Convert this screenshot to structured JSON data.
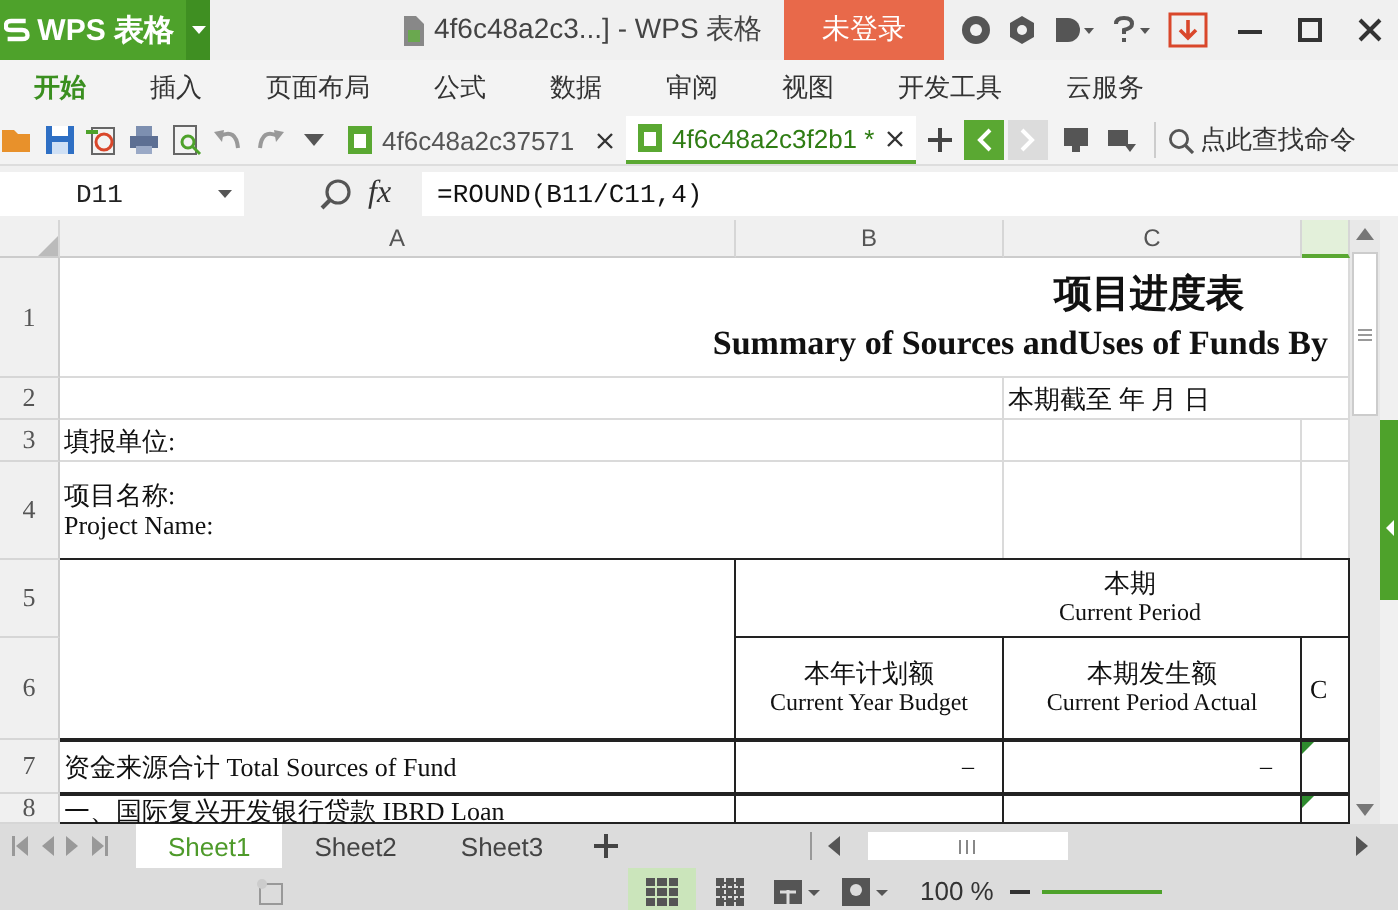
{
  "title_bar": {
    "app_name": "WPS 表格",
    "document_title": "4f6c48a2c3...] - WPS 表格",
    "login_button": "未登录"
  },
  "menu": [
    {
      "label": "开始",
      "selected": true
    },
    {
      "label": "插入",
      "selected": false
    },
    {
      "label": "页面布局",
      "selected": false
    },
    {
      "label": "公式",
      "selected": false
    },
    {
      "label": "数据",
      "selected": false
    },
    {
      "label": "审阅",
      "selected": false
    },
    {
      "label": "视图",
      "selected": false
    },
    {
      "label": "开发工具",
      "selected": false
    },
    {
      "label": "云服务",
      "selected": false
    }
  ],
  "doc_tabs": [
    {
      "label": "4f6c48a2c37571",
      "selected": false
    },
    {
      "label": "4f6c48a2c3f2b1 *",
      "selected": true
    }
  ],
  "search": {
    "placeholder": "点此查找命令"
  },
  "formula_bar": {
    "cell_ref": "D11",
    "fx": "fx",
    "formula": "=ROUND(B11/C11,4)"
  },
  "columns": [
    {
      "label": "A",
      "selected": false
    },
    {
      "label": "B",
      "selected": false
    },
    {
      "label": "C",
      "selected": false
    },
    {
      "selected": true
    }
  ],
  "rows": [
    {
      "number": "1",
      "cells": [
        {
          "lines": [
            "项目进度表",
            "Summary of Sources andUses of Funds By"
          ]
        }
      ]
    },
    {
      "number": "2",
      "cells": [
        {
          "lines": [
            "本期截至      年  月  日"
          ]
        }
      ]
    },
    {
      "number": "3",
      "cells": [
        {
          "lines": [
            "填报单位:"
          ]
        }
      ]
    },
    {
      "number": "4",
      "cells": [
        {
          "lines": [
            "项目名称:",
            "Project Name:"
          ]
        }
      ]
    },
    {
      "number": "5",
      "cells": [
        {
          "lines": [
            "本期",
            "Current Period"
          ]
        }
      ]
    },
    {
      "number": "6",
      "cells": [
        {
          "lines": [
            "本年计划额",
            "Current Year Budget"
          ]
        },
        {
          "lines": [
            "本期发生额",
            "Current Period Actual"
          ]
        },
        {
          "lines": [
            "C"
          ]
        }
      ]
    },
    {
      "number": "7",
      "flagged": true,
      "cells": [
        {
          "lines": [
            "资金来源合计  Total Sources of Fund"
          ]
        },
        {
          "lines": [
            "–"
          ]
        },
        {
          "lines": [
            "–"
          ]
        }
      ]
    },
    {
      "number": "8",
      "flagged": true,
      "cells": [
        {
          "lines": [
            "一、国际复兴开发银行贷款  IBRD Loan"
          ]
        }
      ]
    }
  ],
  "sheet_tabs": [
    {
      "label": "Sheet1",
      "selected": true
    },
    {
      "label": "Sheet2",
      "selected": false
    },
    {
      "label": "Sheet3",
      "selected": false
    }
  ],
  "status_bar": {
    "zoom": "100 %"
  }
}
